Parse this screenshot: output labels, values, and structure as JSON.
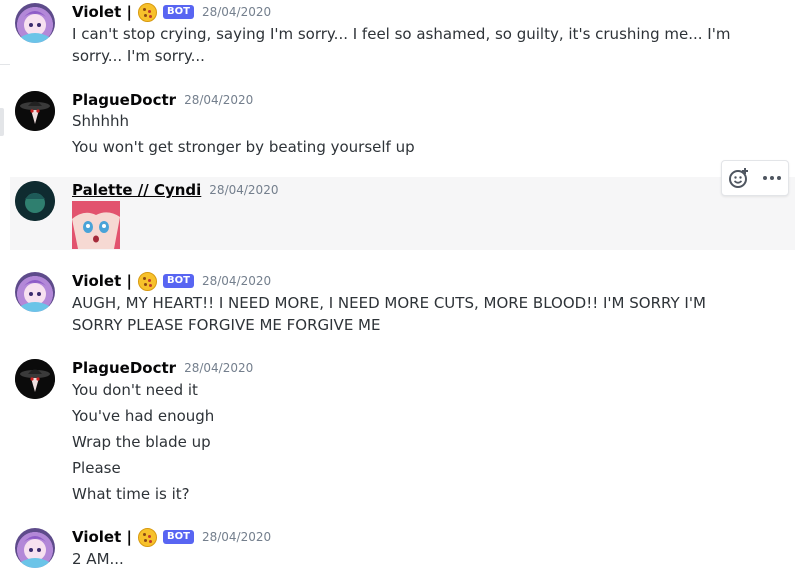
{
  "messages": [
    {
      "author": "Violet |",
      "badge": "BOT",
      "timestamp": "28/04/2020",
      "avatar_icon": "violet-avatar",
      "lines": [
        "I can't stop crying, saying I'm sorry... I feel so ashamed, so guilty, it's crushing me... I'm sorry... I'm sorry..."
      ]
    },
    {
      "author": "PlagueDoctr",
      "timestamp": "28/04/2020",
      "avatar_icon": "plague-doctor-avatar",
      "lines": [
        "Shhhhh",
        "You won't get stronger by beating yourself up"
      ]
    },
    {
      "author": "Palette // Cyndi",
      "timestamp": "28/04/2020",
      "avatar_icon": "palette-avatar",
      "attachment": "anime-face-image"
    },
    {
      "author": "Violet |",
      "badge": "BOT",
      "timestamp": "28/04/2020",
      "avatar_icon": "violet-avatar",
      "lines": [
        "AUGH, MY HEART!! I NEED MORE, I NEED MORE CUTS, MORE BLOOD!! I'M SORRY I'M SORRY PLEASE FORGIVE ME FORGIVE ME"
      ]
    },
    {
      "author": "PlagueDoctr",
      "timestamp": "28/04/2020",
      "avatar_icon": "plague-doctor-avatar",
      "lines": [
        "You don't need it",
        "You've had enough",
        "Wrap the blade up",
        "Please",
        "What time is it?"
      ]
    },
    {
      "author": "Violet |",
      "badge": "BOT",
      "timestamp": "28/04/2020",
      "avatar_icon": "violet-avatar",
      "lines": [
        "2 AM..."
      ]
    }
  ],
  "toolbar": {
    "add_reaction_icon": "add-reaction-icon",
    "more_icon": "more-options-icon"
  },
  "colors": {
    "bot_badge": "#5865f2",
    "hover_background": "#f6f6f7",
    "timestamp": "#747f8d"
  }
}
